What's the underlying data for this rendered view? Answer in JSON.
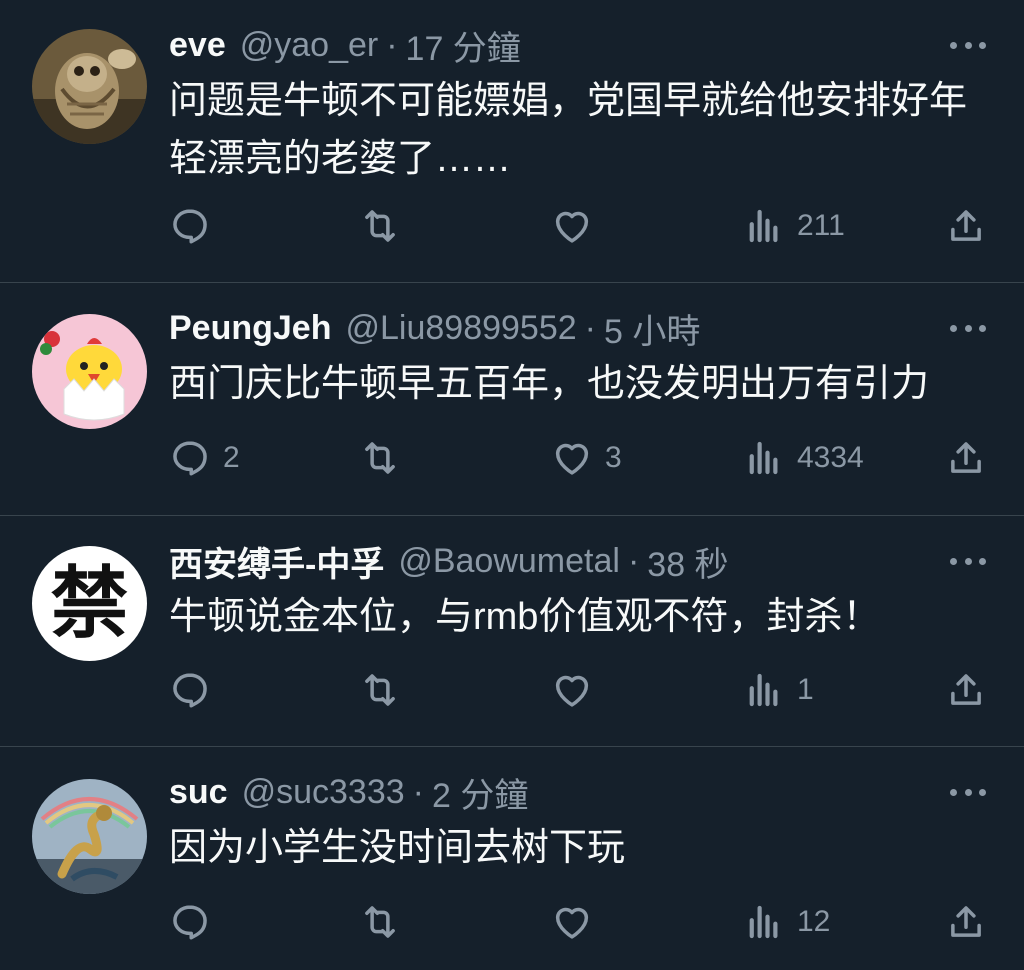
{
  "colors": {
    "background": "#15202b",
    "text": "#f7f9f9",
    "secondary": "#8b98a5",
    "divider": "#38444d"
  },
  "tweets": [
    {
      "name": "eve",
      "handle": "@yao_er",
      "separator": "·",
      "time": "17 分鐘",
      "text": "问题是牛顿不可能嫖娼，党国早就给他安排好年轻漂亮的老婆了……",
      "avatar": "owl-photo-avatar",
      "replies": "",
      "retweets": "",
      "likes": "",
      "views": "211"
    },
    {
      "name": "PeungJeh",
      "handle": "@Liu89899552",
      "separator": "·",
      "time": "5 小時",
      "text": "西门庆比牛顿早五百年，也没发明出万有引力",
      "avatar": "chick-cartoon-avatar",
      "replies": "2",
      "retweets": "",
      "likes": "3",
      "views": "4334"
    },
    {
      "name": "西安缚手-中孚",
      "handle": "@Baowumetal",
      "separator": "·",
      "time": "38 秒",
      "text": "牛顿说金本位，与rmb价值观不符，封杀！",
      "avatar": "forbidden-character-avatar",
      "avatar_text": "禁",
      "replies": "",
      "retweets": "",
      "likes": "",
      "views": "1"
    },
    {
      "name": "suc",
      "handle": "@suc3333",
      "separator": "·",
      "time": "2 分鐘",
      "text": "因为小学生没时间去树下玩",
      "avatar": "dragon-art-avatar",
      "replies": "",
      "retweets": "",
      "likes": "",
      "views": "12"
    }
  ]
}
